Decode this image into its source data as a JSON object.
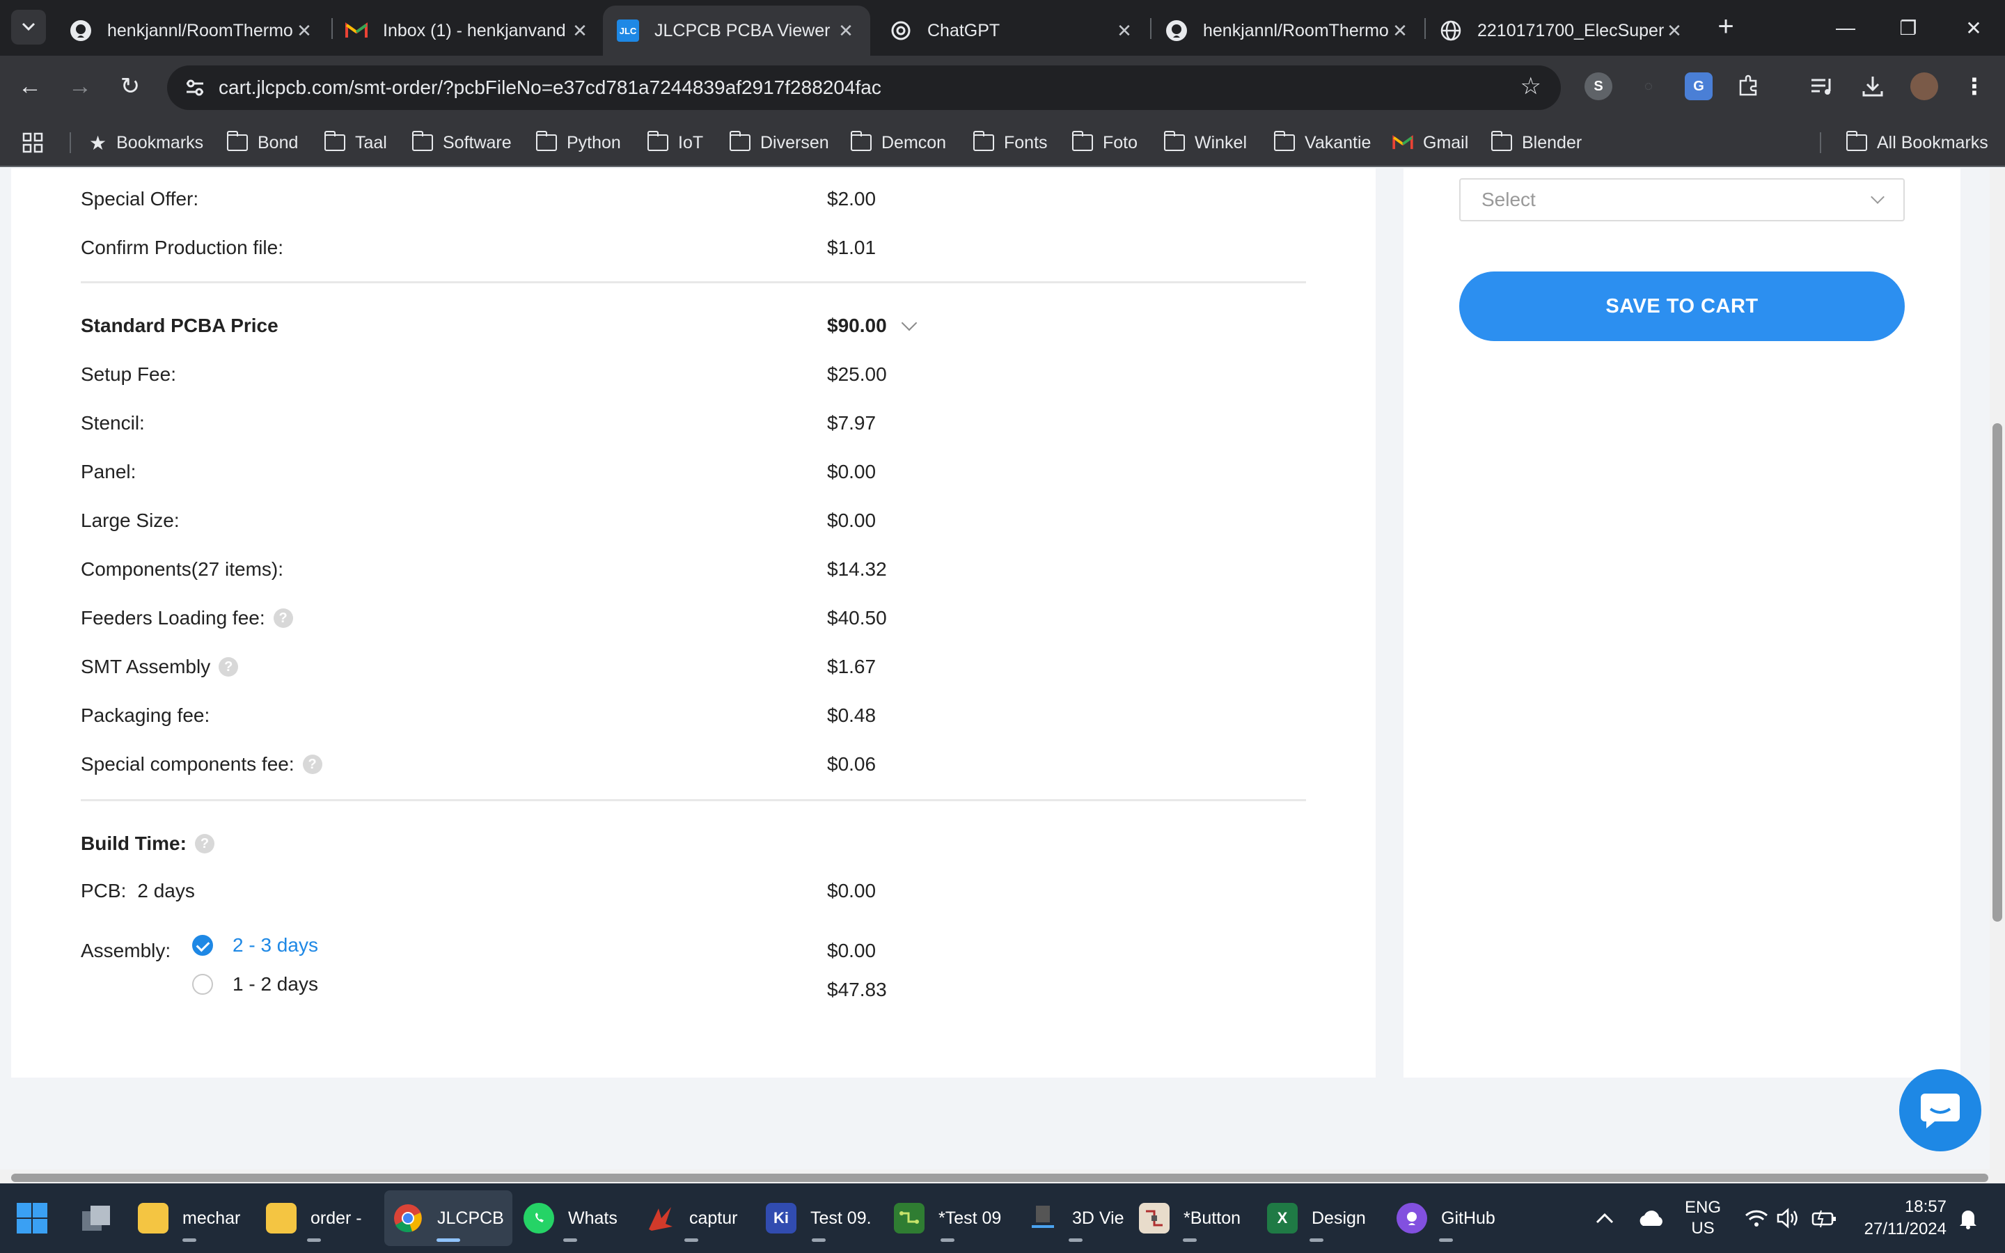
{
  "browser": {
    "tabs": [
      {
        "title": "henkjannl/RoomThermo",
        "icon": "github-icon",
        "active": false
      },
      {
        "title": "Inbox (1) - henkjanvand",
        "icon": "gmail-icon",
        "active": false
      },
      {
        "title": "JLCPCB PCBA Viewer",
        "icon": "jlc-icon",
        "active": true
      },
      {
        "title": "ChatGPT",
        "icon": "chatgpt-icon",
        "active": false
      },
      {
        "title": "henkjannl/RoomThermo",
        "icon": "github-icon",
        "active": false
      },
      {
        "title": "2210171700_ElecSuper",
        "icon": "globe-icon",
        "active": false
      }
    ],
    "jlc_favicon_text": "JLC",
    "address": {
      "domain": "cart.jlcpcb.com",
      "path": "/smt-order/?pcbFileNo=e37cd781a7244839af2917f288204fac"
    },
    "bookmarks": [
      {
        "label": "Bookmarks",
        "icon": "star-icon"
      },
      {
        "label": "Bond",
        "icon": "folder-icon"
      },
      {
        "label": "Taal",
        "icon": "folder-icon"
      },
      {
        "label": "Software",
        "icon": "folder-icon"
      },
      {
        "label": "Python",
        "icon": "folder-icon"
      },
      {
        "label": "IoT",
        "icon": "folder-icon"
      },
      {
        "label": "Diversen",
        "icon": "folder-icon"
      },
      {
        "label": "Demcon",
        "icon": "folder-icon"
      },
      {
        "label": "Fonts",
        "icon": "folder-icon"
      },
      {
        "label": "Foto",
        "icon": "folder-icon"
      },
      {
        "label": "Winkel",
        "icon": "folder-icon"
      },
      {
        "label": "Vakantie",
        "icon": "folder-icon"
      },
      {
        "label": "Gmail",
        "icon": "gmail-icon"
      },
      {
        "label": "Blender",
        "icon": "folder-icon"
      }
    ],
    "all_bookmarks": "All Bookmarks"
  },
  "pricing": {
    "top_rows": [
      {
        "label": "Special Offer:",
        "value": "$2.00"
      },
      {
        "label": "Confirm Production file:",
        "value": "$1.01"
      }
    ],
    "standard": {
      "label": "Standard PCBA Price",
      "value": "$90.00"
    },
    "rows": [
      {
        "label": "Setup Fee:",
        "value": "$25.00",
        "help": false
      },
      {
        "label": "Stencil:",
        "value": "$7.97",
        "help": false
      },
      {
        "label": "Panel:",
        "value": "$0.00",
        "help": false
      },
      {
        "label": "Large Size:",
        "value": "$0.00",
        "help": false
      },
      {
        "label": "Components(27 items):",
        "value": "$14.32",
        "help": false
      },
      {
        "label": "Feeders Loading fee:",
        "value": "$40.50",
        "help": true
      },
      {
        "label": "SMT Assembly",
        "value": "$1.67",
        "help": true
      },
      {
        "label": "Packaging fee:",
        "value": "$0.48",
        "help": false
      },
      {
        "label": "Special components fee:",
        "value": "$0.06",
        "help": true
      }
    ],
    "help_glyph": "?"
  },
  "build_time": {
    "title": "Build Time:",
    "pcb": {
      "label": "PCB:",
      "days": "2 days",
      "value": "$0.00"
    },
    "assembly": {
      "label": "Assembly:",
      "options": [
        {
          "label": "2 - 3 days",
          "value": "$0.00",
          "selected": true
        },
        {
          "label": "1 - 2 days",
          "value": "$47.83",
          "selected": false
        }
      ]
    }
  },
  "sidebar": {
    "select_placeholder": "Select",
    "save_button": "SAVE TO CART"
  },
  "taskbar": {
    "items": [
      {
        "label": "",
        "icon": "task-view-icon"
      },
      {
        "label": "mechar",
        "icon": "folder-icon"
      },
      {
        "label": "order -",
        "icon": "folder-icon"
      },
      {
        "label": "JLCPCB",
        "icon": "chrome-icon"
      },
      {
        "label": "Whats",
        "icon": "whatsapp-icon"
      },
      {
        "label": "captur",
        "icon": "capture-icon"
      },
      {
        "label": "Test 09.",
        "icon": "kicad-icon"
      },
      {
        "label": "*Test 09",
        "icon": "pcb-editor-icon"
      },
      {
        "label": "3D Vie",
        "icon": "3d-viewer-icon"
      },
      {
        "label": "*Button",
        "icon": "schematic-icon"
      },
      {
        "label": "Design",
        "icon": "excel-icon"
      },
      {
        "label": "GitHub",
        "icon": "github-desktop-icon"
      }
    ],
    "kicad_text": "Ki",
    "excel_text": "X",
    "language": "ENG",
    "region": "US",
    "time": "18:57",
    "date": "27/11/2024"
  },
  "colors": {
    "accent": "#1e88e5",
    "button": "#2c8ff0",
    "browser_dark": "#202124",
    "browser_toolbar": "#35363a",
    "taskbar": "#1f2a38"
  }
}
